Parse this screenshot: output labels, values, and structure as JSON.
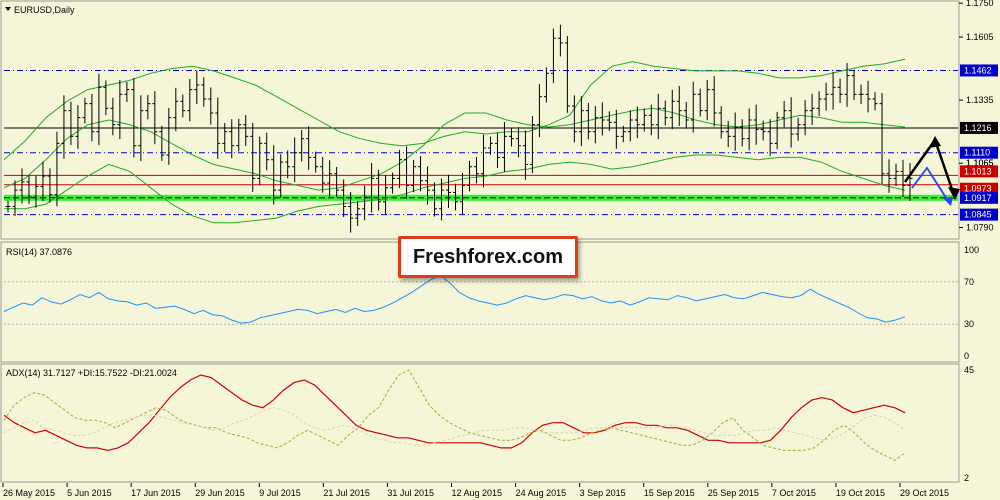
{
  "chart_data": [
    {
      "type": "ohlc",
      "title": "EURUSD,Daily",
      "ylim": [
        1.0745,
        1.1755
      ],
      "y_ticks": [
        "1.1750",
        "1.1605",
        "1.1335",
        "1.1065",
        "1.0790"
      ],
      "x_ticks": [
        "26 May 2015",
        "5 Jun 2015",
        "17 Jun 2015",
        "29 Jun 2015",
        "9 Jul 2015",
        "21 Jul 2015",
        "31 Jul 2015",
        "12 Aug 2015",
        "24 Aug 2015",
        "3 Sep 2015",
        "15 Sep 2015",
        "25 Sep 2015",
        "7 Oct 2015",
        "19 Oct 2015",
        "29 Oct 2015"
      ],
      "close": [
        1.088,
        1.095,
        1.0985,
        1.092,
        1.0965,
        1.101,
        1.093,
        1.115,
        1.129,
        1.118,
        1.126,
        1.132,
        1.12,
        1.139,
        1.13,
        1.123,
        1.136,
        1.138,
        1.114,
        1.129,
        1.132,
        1.12,
        1.11,
        1.126,
        1.133,
        1.129,
        1.138,
        1.14,
        1.134,
        1.128,
        1.115,
        1.12,
        1.114,
        1.123,
        1.118,
        1.1,
        1.115,
        1.108,
        1.095,
        1.107,
        1.105,
        1.111,
        1.117,
        1.109,
        1.105,
        1.098,
        1.102,
        1.095,
        1.088,
        1.083,
        1.087,
        1.092,
        1.1,
        1.09,
        1.096,
        1.1,
        1.108,
        1.097,
        1.105,
        1.099,
        1.095,
        1.087,
        1.095,
        1.094,
        1.09,
        1.097,
        1.105,
        1.102,
        1.113,
        1.115,
        1.109,
        1.118,
        1.117,
        1.114,
        1.106,
        1.123,
        1.135,
        1.145,
        1.16,
        1.158,
        1.131,
        1.12,
        1.129,
        1.12,
        1.126,
        1.125,
        1.124,
        1.118,
        1.12,
        1.125,
        1.123,
        1.127,
        1.123,
        1.13,
        1.126,
        1.133,
        1.129,
        1.125,
        1.136,
        1.129,
        1.138,
        1.128,
        1.12,
        1.118,
        1.122,
        1.117,
        1.125,
        1.121,
        1.12,
        1.115,
        1.126,
        1.129,
        1.119,
        1.123,
        1.129,
        1.13,
        1.134,
        1.136,
        1.139,
        1.136,
        1.144,
        1.136,
        1.136,
        1.134,
        1.132,
        1.102,
        1.1,
        1.103,
        1.097,
        1.1
      ],
      "bollinger_upper": [
        1.108,
        1.116,
        1.126,
        1.133,
        1.138,
        1.14,
        1.142,
        1.145,
        1.147,
        1.148,
        1.146,
        1.143,
        1.14,
        1.135,
        1.13,
        1.125,
        1.12,
        1.117,
        1.115,
        1.114,
        1.115,
        1.118,
        1.12,
        1.119,
        1.12,
        1.12,
        1.123,
        1.127,
        1.14,
        1.148,
        1.15,
        1.148,
        1.147,
        1.146,
        1.146,
        1.146,
        1.145,
        1.143,
        1.143,
        1.144,
        1.146,
        1.148,
        1.149,
        1.151
      ],
      "bollinger_middle": [
        1.096,
        1.1,
        1.108,
        1.117,
        1.123,
        1.125,
        1.123,
        1.12,
        1.115,
        1.11,
        1.106,
        1.104,
        1.102,
        1.099,
        1.097,
        1.095,
        1.096,
        1.099,
        1.102,
        1.107,
        1.114,
        1.123,
        1.128,
        1.128,
        1.125,
        1.123,
        1.122,
        1.123,
        1.125,
        1.127,
        1.129,
        1.13,
        1.128,
        1.125,
        1.123,
        1.122,
        1.123,
        1.125,
        1.127,
        1.126,
        1.124,
        1.124,
        1.123,
        1.122
      ],
      "bollinger_lower": [
        1.087,
        1.087,
        1.089,
        1.095,
        1.101,
        1.106,
        1.103,
        1.096,
        1.089,
        1.084,
        1.081,
        1.081,
        1.082,
        1.083,
        1.086,
        1.088,
        1.089,
        1.09,
        1.091,
        1.093,
        1.096,
        1.098,
        1.1,
        1.101,
        1.103,
        1.104,
        1.106,
        1.107,
        1.106,
        1.104,
        1.105,
        1.107,
        1.109,
        1.11,
        1.11,
        1.109,
        1.108,
        1.109,
        1.109,
        1.107,
        1.103,
        1.1,
        1.097,
        1.095
      ],
      "levels": [
        {
          "label": "1.1462",
          "value": 1.1462,
          "color": "#0000cc",
          "style": "dashdot"
        },
        {
          "label": "1.1216",
          "value": 1.1216,
          "color": "#000000",
          "style": "solid"
        },
        {
          "label": "1.1110",
          "value": 1.111,
          "color": "#0000cc",
          "style": "dashdot"
        },
        {
          "label": "1.1013",
          "value": 1.1013,
          "color": "#cc0000",
          "style": "solid"
        },
        {
          "label": "1.0973",
          "value": 1.0973,
          "color": "#cc0000",
          "style": "solid"
        },
        {
          "label": "1.0917",
          "value": 1.0917,
          "color": "#00cc00",
          "style": "support-band"
        },
        {
          "label": "1.0845",
          "value": 1.0845,
          "color": "#0000cc",
          "style": "dashdot"
        }
      ],
      "right_price_labels": [
        "1.1110",
        "1.1065"
      ]
    },
    {
      "type": "line",
      "title": "RSI(14) 37.0876",
      "ylim": [
        0,
        100
      ],
      "y_ticks": [
        "100",
        "70",
        "30",
        "0"
      ],
      "series": [
        {
          "values": [
            42,
            46,
            50,
            48,
            55,
            51,
            49,
            53,
            58,
            55,
            60,
            54,
            52,
            51,
            48,
            50,
            45,
            46,
            47,
            44,
            40,
            43,
            39,
            38,
            34,
            31,
            32,
            36,
            38,
            40,
            42,
            44,
            43,
            40,
            42,
            44,
            41,
            45,
            42,
            43,
            46,
            50,
            55,
            60,
            66,
            72,
            76,
            69,
            60,
            55,
            52,
            50,
            48,
            50,
            54,
            57,
            55,
            53,
            55,
            58,
            57,
            54,
            56,
            52,
            50,
            52,
            48,
            51,
            55,
            54,
            53,
            57,
            55,
            52,
            54,
            56,
            58,
            55,
            54,
            57,
            60,
            58,
            56,
            55,
            57,
            63,
            58,
            54,
            50,
            46,
            41,
            36,
            35,
            32,
            34,
            37
          ]
        }
      ]
    },
    {
      "type": "line",
      "title": "ADX(14) 31.7127 +DI:15.7522 -DI:21.0024",
      "y_ticks": [
        "45",
        "2"
      ],
      "series": [
        {
          "values": [
            27,
            24,
            22,
            20,
            21,
            19,
            17,
            15,
            14,
            14,
            13,
            14,
            16,
            20,
            24,
            29,
            34,
            38,
            41,
            43,
            42,
            39,
            36,
            33,
            31,
            30,
            33,
            37,
            40,
            41,
            39,
            35,
            31,
            27,
            23,
            21,
            20,
            19,
            18,
            18,
            17,
            16,
            16,
            16,
            16,
            16,
            16,
            15,
            14,
            14,
            16,
            20,
            23,
            24,
            24,
            22,
            20,
            20,
            21,
            23,
            24,
            24,
            23,
            23,
            22,
            22,
            21,
            19,
            17,
            17,
            16,
            16,
            16,
            16,
            17,
            21,
            26,
            30,
            33,
            34,
            33,
            30,
            28,
            29,
            30,
            31,
            30,
            28
          ]
        },
        {
          "values": [
            25,
            31,
            34,
            36,
            35,
            32,
            29,
            26,
            25,
            25,
            24,
            22,
            24,
            26,
            28,
            30,
            29,
            26,
            24,
            23,
            22,
            22,
            20,
            19,
            18,
            16,
            15,
            14,
            16,
            19,
            21,
            19,
            17,
            15,
            19,
            22,
            27,
            30,
            37,
            43,
            45,
            38,
            31,
            27,
            24,
            22,
            20,
            19,
            18,
            17,
            17,
            18,
            20,
            21,
            19,
            17,
            17,
            18,
            20,
            21,
            22,
            21,
            20,
            19,
            18,
            17,
            16,
            15,
            15,
            17,
            20,
            24,
            26,
            21,
            18,
            15,
            14,
            13,
            13,
            13,
            14,
            17,
            21,
            23,
            20,
            16,
            13,
            11,
            9,
            12
          ]
        },
        {
          "values": [
            20,
            22,
            24,
            25,
            22,
            21,
            20,
            19,
            19,
            20,
            22,
            24,
            25,
            26,
            27,
            27,
            26,
            25,
            24,
            23,
            22,
            21,
            22,
            24,
            25,
            27,
            29,
            30,
            29,
            27,
            24,
            22,
            21,
            22,
            23,
            22,
            20,
            18,
            17,
            16,
            16,
            15,
            15,
            16,
            17,
            18,
            19,
            20,
            21,
            21,
            21,
            22,
            22,
            21,
            20,
            20,
            20,
            20,
            21,
            22,
            22,
            22,
            22,
            22,
            22,
            22,
            23,
            23,
            22,
            21,
            20,
            19,
            19,
            19,
            20,
            21,
            21,
            22,
            21,
            20,
            19,
            18,
            17,
            18,
            20,
            23,
            26,
            27,
            26,
            24,
            21
          ]
        }
      ]
    }
  ],
  "brand": {
    "text": "Freshforex.com"
  },
  "colors": {
    "background": "#f5f6d8",
    "candles": "#000000",
    "bollinger": "#22aa22",
    "rsi": "#1e90ff",
    "adx": "#cc0000",
    "plus_di": "#aaaa33",
    "minus_di": "#d6d6a8",
    "arrow_black": "#000000",
    "arrow_blue": "#2244ff"
  }
}
